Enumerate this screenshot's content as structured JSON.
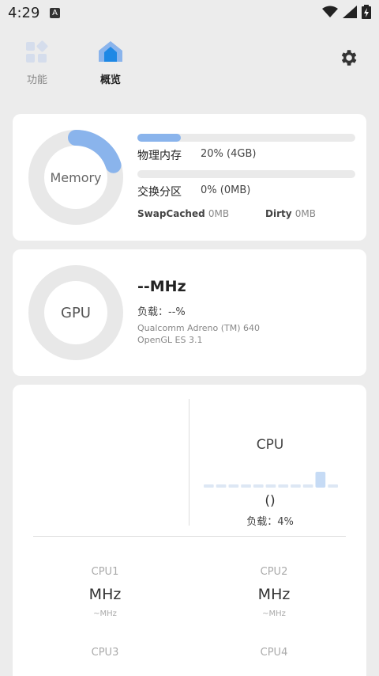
{
  "status": {
    "time": "4:29",
    "a_icon": "A"
  },
  "tabs": [
    {
      "label": "功能",
      "active": false
    },
    {
      "label": "概览",
      "active": true
    }
  ],
  "colors": {
    "accent": "#8ab4ec",
    "tab_blue": "#1e88e5"
  },
  "memory": {
    "ring_label": "Memory",
    "physical": {
      "label": "物理内存",
      "value": "20% (4GB)",
      "percent": 20
    },
    "swap": {
      "label": "交换分区",
      "value": "0% (0MB)",
      "percent": 0
    },
    "swap_cached": {
      "label": "SwapCached",
      "value": "0MB"
    },
    "dirty": {
      "label": "Dirty",
      "value": "0MB"
    }
  },
  "gpu": {
    "ring_label": "GPU",
    "freq": "--MHz",
    "load": "负载：--%",
    "renderer": "Qualcomm Adreno (TM) 640",
    "opengl": "OpenGL ES 3.1"
  },
  "cpu": {
    "title": "CPU",
    "paren": "()",
    "load": "负载：4%",
    "load_history": [
      0,
      0,
      0,
      0,
      0,
      0,
      0,
      0,
      0,
      4,
      0
    ],
    "cores": [
      {
        "name": "CPU1",
        "mhz": "MHz",
        "sub": "~MHz"
      },
      {
        "name": "CPU2",
        "mhz": "MHz",
        "sub": "~MHz"
      },
      {
        "name": "CPU3",
        "mhz": "",
        "sub": ""
      },
      {
        "name": "CPU4",
        "mhz": "",
        "sub": ""
      }
    ]
  }
}
